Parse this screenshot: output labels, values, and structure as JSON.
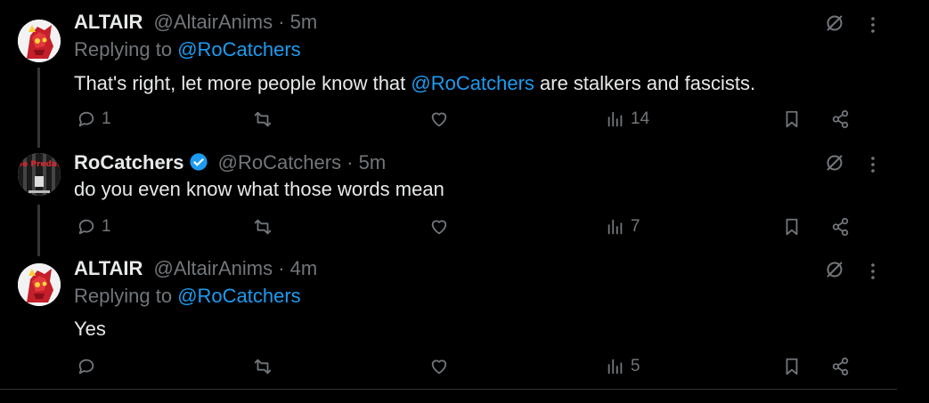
{
  "tweets": [
    {
      "name": "ALTAIR",
      "handle": "@AltairAnims",
      "sep": " · ",
      "time": "5m",
      "reply_prefix": "Replying to ",
      "reply_mention": "@RoCatchers",
      "text_before": "That's right, let more people know that ",
      "text_mention": "@RoCatchers",
      "text_after": " are stalkers and fascists.",
      "replies": "1",
      "retweets": "",
      "likes": "",
      "views": "14"
    },
    {
      "name": "RoCatchers",
      "handle": "@RoCatchers",
      "sep": " · ",
      "time": "5m",
      "text": "do you even know what those words mean",
      "replies": "1",
      "retweets": "",
      "likes": "",
      "views": "7",
      "avatar_text": "Free Predator"
    },
    {
      "name": "ALTAIR",
      "handle": "@AltairAnims",
      "sep": " · ",
      "time": "4m",
      "reply_prefix": "Replying to ",
      "reply_mention": "@RoCatchers",
      "text": "Yes",
      "replies": "",
      "retweets": "",
      "likes": "",
      "views": "5"
    }
  ],
  "colors": {
    "background": "#000000",
    "text": "#e7e9ea",
    "muted": "#71767b",
    "accent": "#1d9bf0"
  },
  "icons": [
    "grok-icon",
    "more-icon",
    "reply-icon",
    "retweet-icon",
    "like-icon",
    "views-icon",
    "bookmark-icon",
    "share-icon",
    "verified-badge-icon"
  ]
}
